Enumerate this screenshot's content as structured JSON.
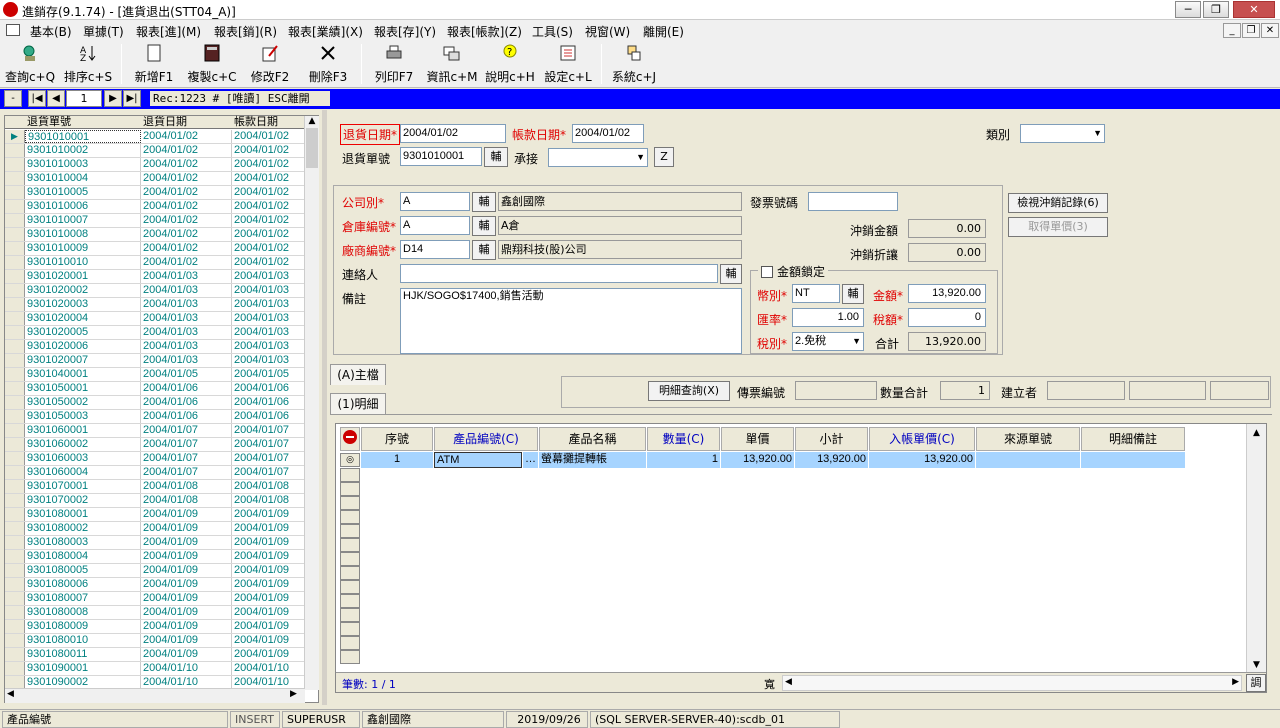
{
  "window": {
    "title": "進銷存(9.1.74) - [進貨退出(STT04_A)]"
  },
  "menu": [
    "基本(B)",
    "單據(T)",
    "報表[進](M)",
    "報表[銷](R)",
    "報表[業績](X)",
    "報表[存](Y)",
    "報表[帳款](Z)",
    "工具(S)",
    "視窗(W)",
    "離開(E)"
  ],
  "toolbar": [
    {
      "label": "查詢c+Q",
      "icon": "query-icon"
    },
    {
      "label": "排序c+S",
      "icon": "sort-icon"
    },
    {
      "label": "新增F1",
      "icon": "new-icon"
    },
    {
      "label": "複製c+C",
      "icon": "copy-icon"
    },
    {
      "label": "修改F2",
      "icon": "edit-icon"
    },
    {
      "label": "刪除F3",
      "icon": "delete-icon"
    },
    {
      "label": "列印F7",
      "icon": "print-icon"
    },
    {
      "label": "資訊c+M",
      "icon": "info-icon"
    },
    {
      "label": "說明c+H",
      "icon": "help-icon"
    },
    {
      "label": "設定c+L",
      "icon": "settings-icon"
    },
    {
      "label": "系統c+J",
      "icon": "system-icon"
    }
  ],
  "nav": {
    "page": "1",
    "status": "Rec:1223 # [唯讀] ESC離開"
  },
  "list": {
    "headers": [
      "退貨單號",
      "退貨日期",
      "帳款日期"
    ],
    "rows": [
      [
        "9301010001",
        "2004/01/02",
        "2004/01/02"
      ],
      [
        "9301010002",
        "2004/01/02",
        "2004/01/02"
      ],
      [
        "9301010003",
        "2004/01/02",
        "2004/01/02"
      ],
      [
        "9301010004",
        "2004/01/02",
        "2004/01/02"
      ],
      [
        "9301010005",
        "2004/01/02",
        "2004/01/02"
      ],
      [
        "9301010006",
        "2004/01/02",
        "2004/01/02"
      ],
      [
        "9301010007",
        "2004/01/02",
        "2004/01/02"
      ],
      [
        "9301010008",
        "2004/01/02",
        "2004/01/02"
      ],
      [
        "9301010009",
        "2004/01/02",
        "2004/01/02"
      ],
      [
        "9301010010",
        "2004/01/02",
        "2004/01/02"
      ],
      [
        "9301020001",
        "2004/01/03",
        "2004/01/03"
      ],
      [
        "9301020002",
        "2004/01/03",
        "2004/01/03"
      ],
      [
        "9301020003",
        "2004/01/03",
        "2004/01/03"
      ],
      [
        "9301020004",
        "2004/01/03",
        "2004/01/03"
      ],
      [
        "9301020005",
        "2004/01/03",
        "2004/01/03"
      ],
      [
        "9301020006",
        "2004/01/03",
        "2004/01/03"
      ],
      [
        "9301020007",
        "2004/01/03",
        "2004/01/03"
      ],
      [
        "9301040001",
        "2004/01/05",
        "2004/01/05"
      ],
      [
        "9301050001",
        "2004/01/06",
        "2004/01/06"
      ],
      [
        "9301050002",
        "2004/01/06",
        "2004/01/06"
      ],
      [
        "9301050003",
        "2004/01/06",
        "2004/01/06"
      ],
      [
        "9301060001",
        "2004/01/07",
        "2004/01/07"
      ],
      [
        "9301060002",
        "2004/01/07",
        "2004/01/07"
      ],
      [
        "9301060003",
        "2004/01/07",
        "2004/01/07"
      ],
      [
        "9301060004",
        "2004/01/07",
        "2004/01/07"
      ],
      [
        "9301070001",
        "2004/01/08",
        "2004/01/08"
      ],
      [
        "9301070002",
        "2004/01/08",
        "2004/01/08"
      ],
      [
        "9301080001",
        "2004/01/09",
        "2004/01/09"
      ],
      [
        "9301080002",
        "2004/01/09",
        "2004/01/09"
      ],
      [
        "9301080003",
        "2004/01/09",
        "2004/01/09"
      ],
      [
        "9301080004",
        "2004/01/09",
        "2004/01/09"
      ],
      [
        "9301080005",
        "2004/01/09",
        "2004/01/09"
      ],
      [
        "9301080006",
        "2004/01/09",
        "2004/01/09"
      ],
      [
        "9301080007",
        "2004/01/09",
        "2004/01/09"
      ],
      [
        "9301080008",
        "2004/01/09",
        "2004/01/09"
      ],
      [
        "9301080009",
        "2004/01/09",
        "2004/01/09"
      ],
      [
        "9301080010",
        "2004/01/09",
        "2004/01/09"
      ],
      [
        "9301080011",
        "2004/01/09",
        "2004/01/09"
      ],
      [
        "9301090001",
        "2004/01/10",
        "2004/01/10"
      ],
      [
        "9301090002",
        "2004/01/10",
        "2004/01/10"
      ]
    ]
  },
  "header_form": {
    "return_date_label": "退貨日期*",
    "return_date": "2004/01/02",
    "account_date_label": "帳款日期*",
    "account_date": "2004/01/02",
    "category_label": "類別",
    "category": "",
    "return_no_label": "退貨單號",
    "return_no": "9301010001",
    "aux_btn": "輔",
    "assign_label": "承接",
    "assign": "",
    "z_btn": "Z"
  },
  "detail_form": {
    "company_label": "公司別*",
    "company_code": "A",
    "company_name": "鑫創國際",
    "warehouse_label": "倉庫編號*",
    "warehouse_code": "A",
    "warehouse_name": "A倉",
    "vendor_label": "廠商編號*",
    "vendor_code": "D14",
    "vendor_name": "鼎翔科技(股)公司",
    "contact_label": "連絡人",
    "contact": "",
    "note_label": "備註",
    "note": "HJK/SOGO$17400,銷售活動",
    "invoice_label": "發票號碼",
    "invoice": "",
    "offset_amount_label": "沖銷金額",
    "offset_amount": "0.00",
    "offset_discount_label": "沖銷折讓",
    "offset_discount": "0.00",
    "view_offset_btn": "檢視沖銷記錄(6)",
    "get_price_btn": "取得單價(3)",
    "lock_label": "金額鎖定",
    "currency_label": "幣別*",
    "currency": "NT",
    "amount_label": "金額*",
    "amount": "13,920.00",
    "rate_label": "匯率*",
    "rate": "1.00",
    "tax_label": "稅額*",
    "tax": "0",
    "tax_type_label": "稅別*",
    "tax_type": "2.免稅",
    "total_label": "合計",
    "total": "13,920.00"
  },
  "tabs": {
    "main": "(A)主檔",
    "detail": "(1)明細"
  },
  "summary": {
    "query_btn": "明細查詢(X)",
    "voucher_label": "傳票編號",
    "qty_total_label": "數量合計",
    "qty_total": "1",
    "creator_label": "建立者"
  },
  "grid": {
    "columns": [
      "序號",
      "產品編號(C)",
      "產品名稱",
      "數量(C)",
      "單價",
      "小計",
      "入帳單價(C)",
      "來源單號",
      "明細備註"
    ],
    "rows": [
      [
        "1",
        "ATM",
        "螢幕攤提轉帳",
        "1",
        "13,920.00",
        "13,920.00",
        "13,920.00",
        "",
        ""
      ]
    ],
    "footer": "筆數: 1 / 1",
    "width_label": "寬",
    "adjust_btn": "調"
  },
  "status": [
    "產品編號",
    "INSERT",
    "SUPERUSR",
    "鑫創國際",
    "2019/09/26",
    "(SQL SERVER-SERVER-40):scdb_01"
  ]
}
